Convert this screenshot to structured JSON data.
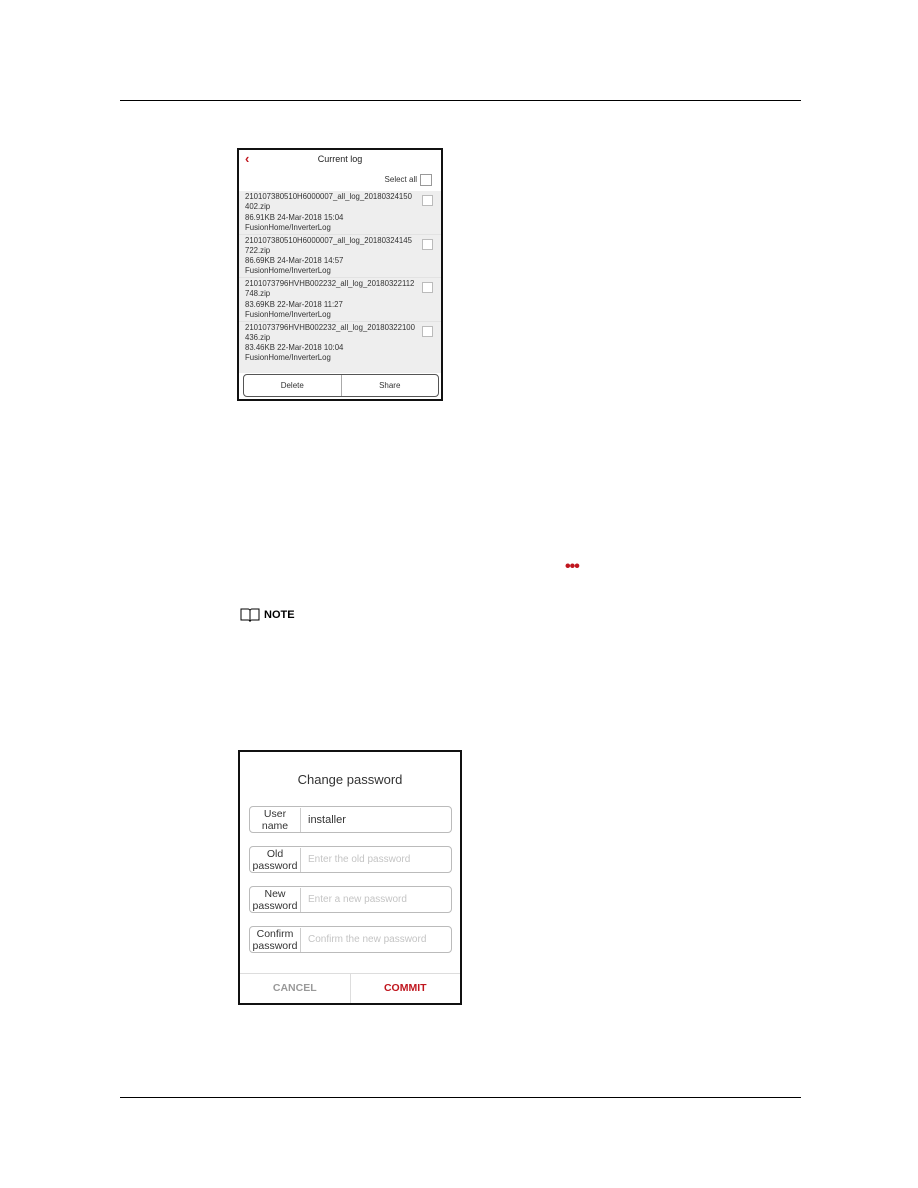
{
  "current_log": {
    "title": "Current log",
    "back_icon": "chevron-left-icon",
    "select_all": "Select all",
    "items": [
      {
        "name_line1": "210107380510H6000007_all_log_20180324150",
        "name_line2": "402.zip",
        "meta": "86.91KB 24-Mar-2018 15:04",
        "path": "FusionHome/InverterLog"
      },
      {
        "name_line1": "210107380510H6000007_all_log_20180324145",
        "name_line2": "722.zip",
        "meta": "86.69KB 24-Mar-2018 14:57",
        "path": "FusionHome/InverterLog"
      },
      {
        "name_line1": "2101073796HVHB002232_all_log_20180322112",
        "name_line2": "748.zip",
        "meta": "83.69KB 22-Mar-2018 11:27",
        "path": "FusionHome/InverterLog"
      },
      {
        "name_line1": "2101073796HVHB002232_all_log_20180322100",
        "name_line2": "436.zip",
        "meta": "83.46KB 22-Mar-2018 10:04",
        "path": "FusionHome/InverterLog"
      }
    ],
    "delete": "Delete",
    "share": "Share"
  },
  "more_icon": "more-dots-icon",
  "note": {
    "icon": "book-icon",
    "label": "NOTE"
  },
  "change_password": {
    "title": "Change password",
    "fields": [
      {
        "label1": "User",
        "label2": "name",
        "value": "installer",
        "placeholder": ""
      },
      {
        "label1": "Old",
        "label2": "password",
        "value": "",
        "placeholder": "Enter the old password"
      },
      {
        "label1": "New",
        "label2": "password",
        "value": "",
        "placeholder": "Enter a new password"
      },
      {
        "label1": "Confirm",
        "label2": "password",
        "value": "",
        "placeholder": "Confirm the new password"
      }
    ],
    "cancel": "CANCEL",
    "commit": "COMMIT"
  },
  "colors": {
    "accent": "#c0161e",
    "cancel": "#999999"
  }
}
